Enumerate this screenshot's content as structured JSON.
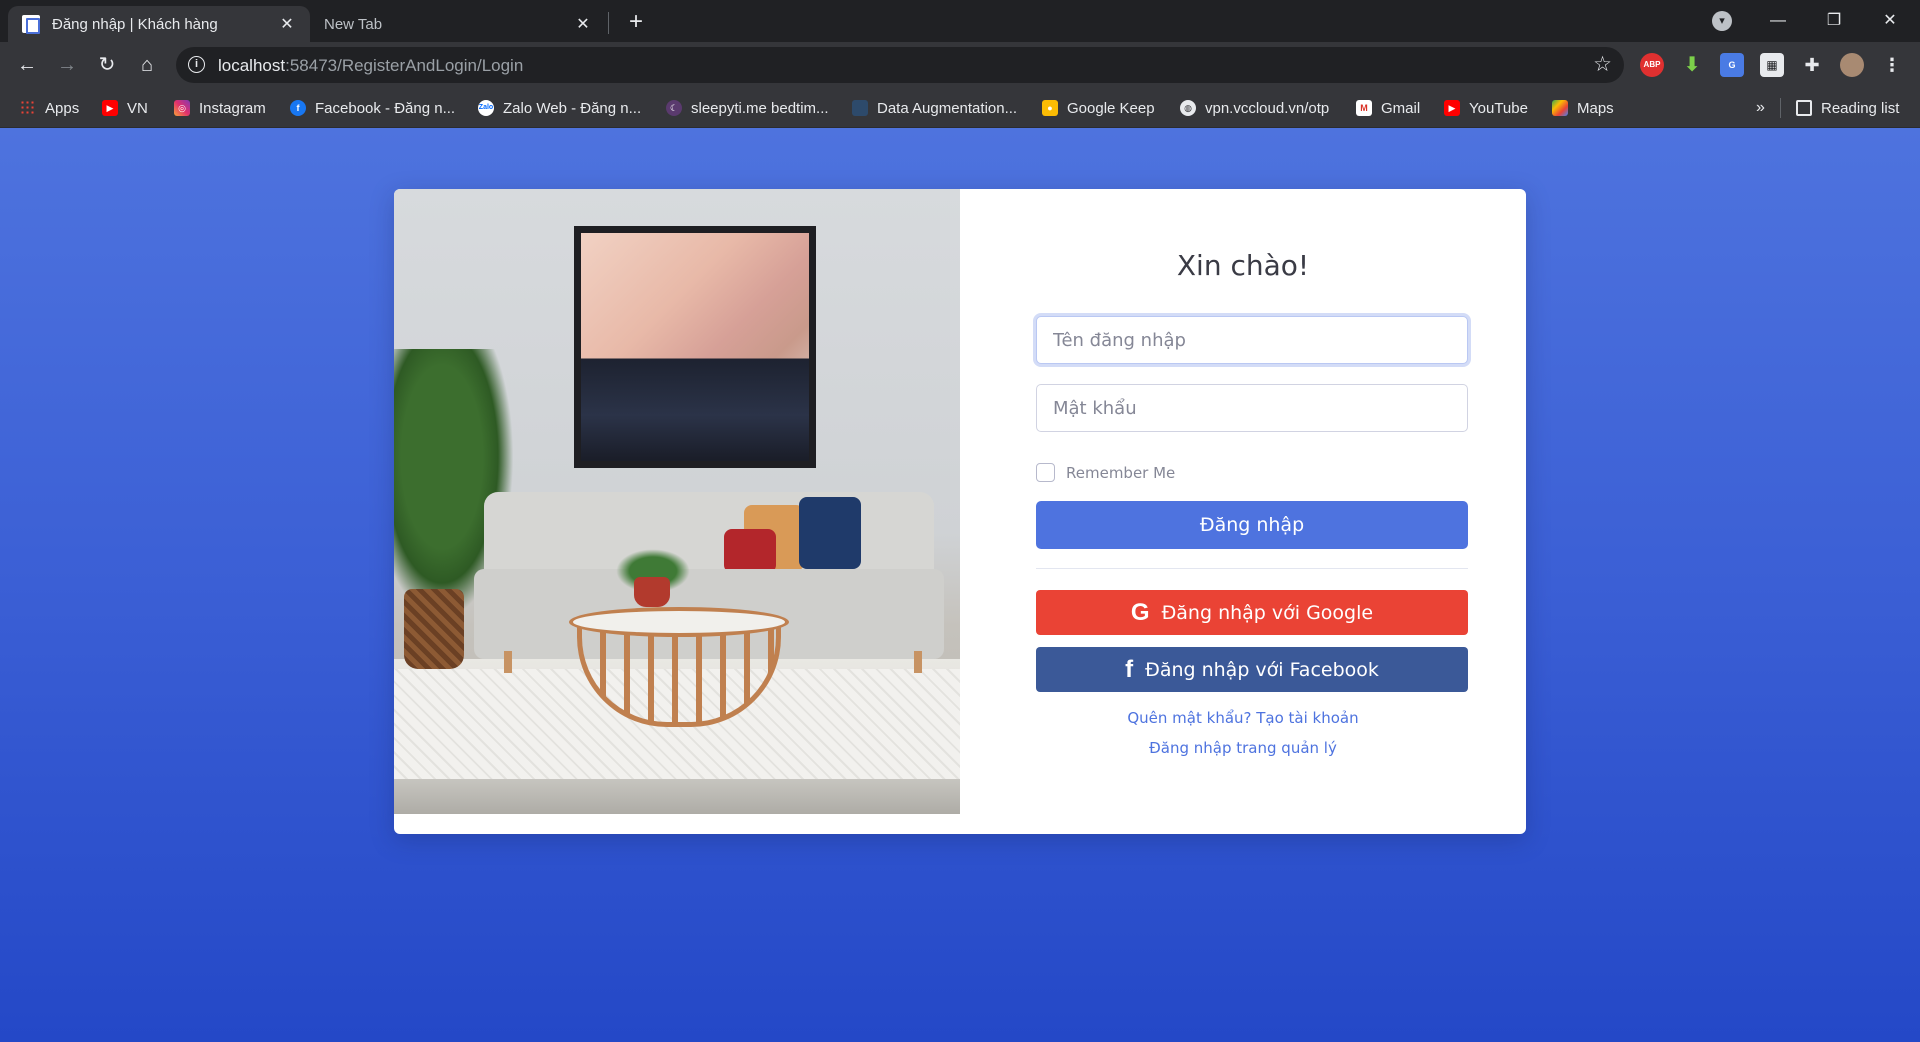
{
  "browser": {
    "tabs": [
      {
        "title": "Đăng nhập | Khách hàng",
        "active": true
      },
      {
        "title": "New Tab",
        "active": false
      }
    ],
    "url_host": "localhost",
    "url_rest": ":58473/RegisterAndLogin/Login",
    "bookmarks": [
      {
        "label": "Apps",
        "icon": "apps-grid-icon"
      },
      {
        "label": "VN",
        "icon": "youtube-icon"
      },
      {
        "label": "Instagram",
        "icon": "instagram-icon"
      },
      {
        "label": "Facebook - Đăng n...",
        "icon": "facebook-icon"
      },
      {
        "label": "Zalo Web - Đăng n...",
        "icon": "zalo-icon"
      },
      {
        "label": "sleepyti.me bedtim...",
        "icon": "sleepytime-icon"
      },
      {
        "label": "Data Augmentation...",
        "icon": "document-icon"
      },
      {
        "label": "Google Keep",
        "icon": "keep-icon"
      },
      {
        "label": "vpn.vccloud.vn/otp",
        "icon": "globe-icon"
      },
      {
        "label": "Gmail",
        "icon": "gmail-icon"
      },
      {
        "label": "YouTube",
        "icon": "youtube-icon"
      },
      {
        "label": "Maps",
        "icon": "maps-icon"
      }
    ],
    "bookmarks_more": "»",
    "reading_list": "Reading list",
    "extensions": {
      "abp": "ABP"
    }
  },
  "login": {
    "heading": "Xin chào!",
    "username_placeholder": "Tên đăng nhập",
    "password_placeholder": "Mật khẩu",
    "remember_label": "Remember Me",
    "login_button": "Đăng nhập",
    "google_button": "Đăng nhập với Google",
    "facebook_button": "Đăng nhập với Facebook",
    "forgot_link": "Quên mật khẩu? Tạo tài khoản",
    "admin_link": "Đăng nhập trang quản lý"
  },
  "colors": {
    "primary": "#4e73df",
    "google": "#ea4335",
    "facebook": "#3b5998"
  }
}
